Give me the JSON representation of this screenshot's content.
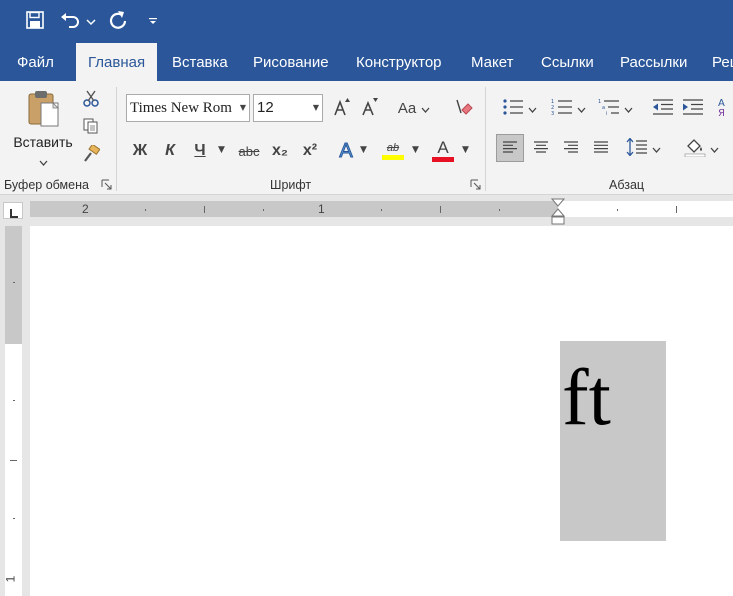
{
  "quick_access": {
    "save_icon": "save-icon",
    "undo_icon": "undo-icon",
    "redo_icon": "redo-icon",
    "customize_icon": "customize-qat-icon"
  },
  "tabs": [
    {
      "label": "Файл",
      "active": false
    },
    {
      "label": "Главная",
      "active": true
    },
    {
      "label": "Вставка",
      "active": false
    },
    {
      "label": "Рисование",
      "active": false
    },
    {
      "label": "Конструктор",
      "active": false
    },
    {
      "label": "Макет",
      "active": false
    },
    {
      "label": "Ссылки",
      "active": false
    },
    {
      "label": "Рассылки",
      "active": false
    },
    {
      "label": "Рец",
      "active": false
    }
  ],
  "clipboard": {
    "paste_label": "Вставить",
    "group_label": "Буфер обмена"
  },
  "font": {
    "font_name": "Times New Rom",
    "font_size": "12",
    "change_case_label": "Aa",
    "bold_label": "Ж",
    "italic_label": "К",
    "underline_label": "Ч",
    "strike_label": "abc",
    "subscript_label": "x₂",
    "superscript_label": "x²",
    "effects_label": "A",
    "highlight_label": "ab",
    "font_color_label": "A",
    "highlight_color": "#ffff00",
    "font_color": "#e81123",
    "group_label": "Шрифт"
  },
  "paragraph": {
    "group_label": "Абзац"
  },
  "ruler": {
    "labels": [
      "2",
      "1"
    ]
  },
  "vruler": {
    "labels": [
      "1"
    ]
  },
  "document": {
    "text": "ft"
  },
  "colors": {
    "title_bar": "#2b579a",
    "ribbon": "#f3f3f3"
  }
}
